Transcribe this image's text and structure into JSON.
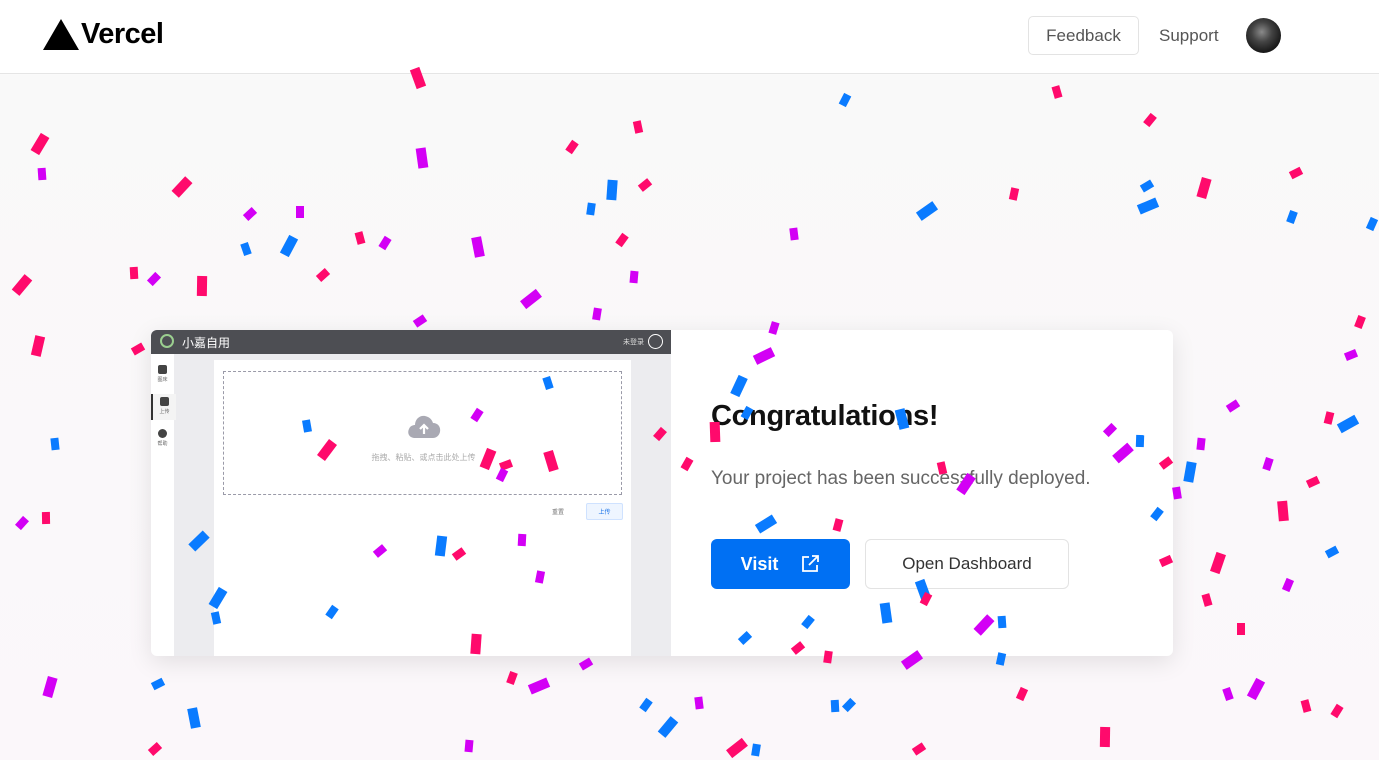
{
  "header": {
    "brand": "Vercel",
    "feedback_label": "Feedback",
    "support_label": "Support",
    "avatar_icon": "user-avatar"
  },
  "preview": {
    "app_title": "小嘉自用",
    "login_text": "未登录",
    "sidebar": [
      {
        "label": "图床"
      },
      {
        "label": "上传"
      },
      {
        "label": "帮助"
      }
    ],
    "drop_text": "拖拽、粘贴、或点击此处上传",
    "reset_label": "重置",
    "upload_label": "上传",
    "cloud_icon": "cloud-upload-icon"
  },
  "deploy": {
    "title": "Congratulations!",
    "message": "Your project has been successfully deployed.",
    "visit_label": "Visit",
    "dashboard_label": "Open Dashboard",
    "visit_icon": "external-link-icon"
  },
  "colors": {
    "accent": "#0070f3",
    "confetti": [
      "#ff0a6c",
      "#d300f5",
      "#0a7bff"
    ]
  }
}
